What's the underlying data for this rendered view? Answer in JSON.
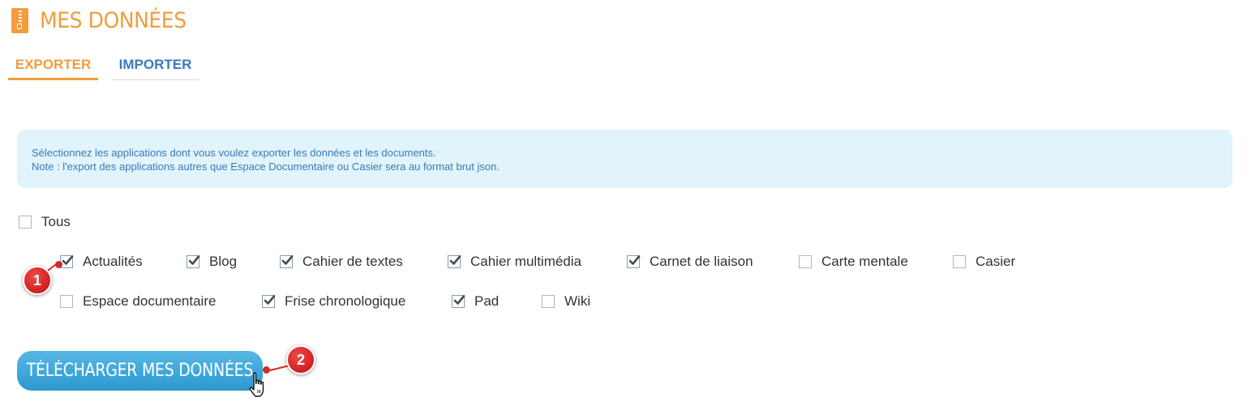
{
  "header": {
    "title": "MES DONNÉES",
    "icon": "zip-file-icon",
    "accent_color": "#f39c3c"
  },
  "tabs": [
    {
      "label": "EXPORTER",
      "active": true
    },
    {
      "label": "IMPORTER",
      "active": false
    }
  ],
  "info": {
    "line1": "Sélectionnez les applications dont vous voulez exporter les données et les documents.",
    "line2": "Note : l'export des applications autres que Espace Documentaire ou Casier sera au format brut json."
  },
  "select_all": {
    "label": "Tous",
    "checked": false
  },
  "apps": [
    {
      "label": "Actualités",
      "checked": true
    },
    {
      "label": "Blog",
      "checked": true
    },
    {
      "label": "Cahier de textes",
      "checked": true
    },
    {
      "label": "Cahier multimédia",
      "checked": true
    },
    {
      "label": "Carnet de liaison",
      "checked": true
    },
    {
      "label": "Carte mentale",
      "checked": false
    },
    {
      "label": "Casier",
      "checked": false
    },
    {
      "label": "Espace documentaire",
      "checked": false
    },
    {
      "label": "Frise chronologique",
      "checked": true
    },
    {
      "label": "Pad",
      "checked": true
    },
    {
      "label": "Wiki",
      "checked": false
    }
  ],
  "download_button": {
    "label": "TÉLÉCHARGER MES DONNÉES",
    "color": "#3ea8db"
  },
  "markers": [
    {
      "label": "1"
    },
    {
      "label": "2"
    }
  ]
}
